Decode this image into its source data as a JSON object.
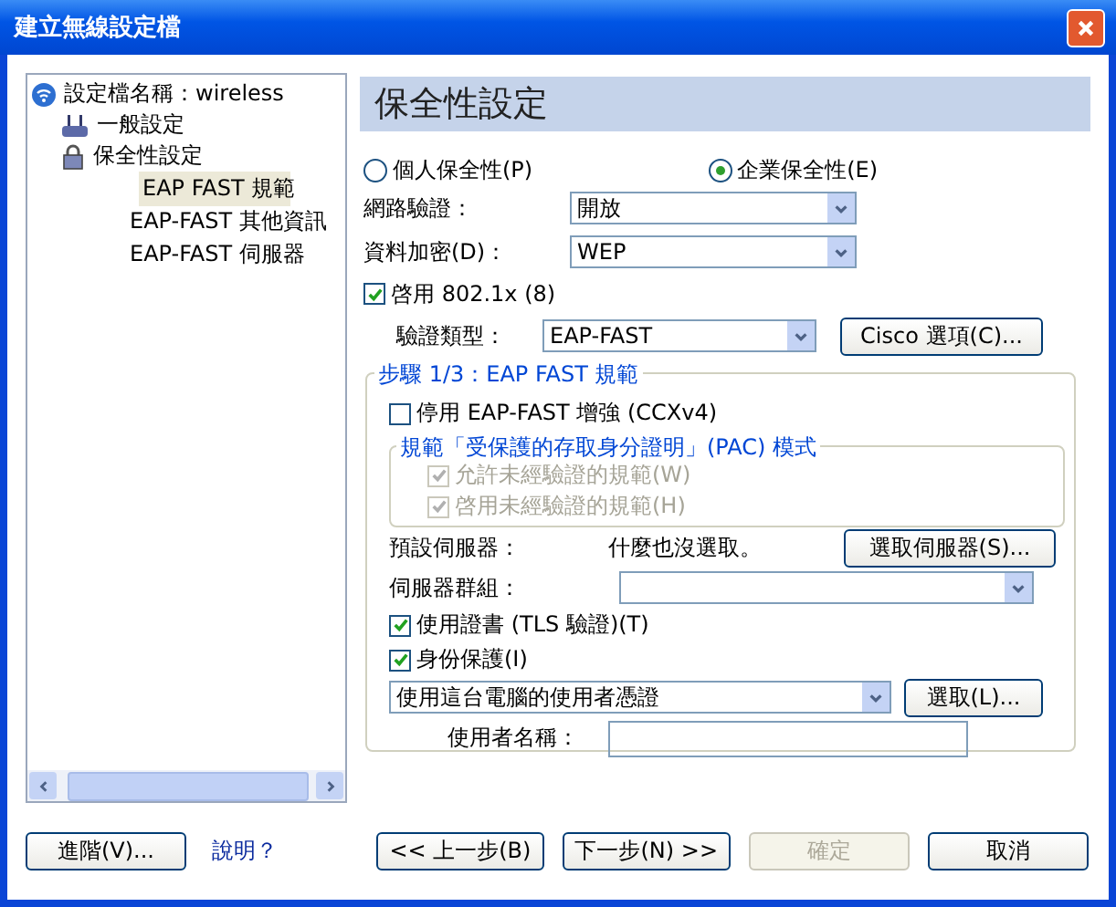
{
  "window": {
    "title": "建立無線設定檔"
  },
  "tree": {
    "label": "設定檔名稱：wireless",
    "children": [
      {
        "label": "一般設定",
        "kind": "router"
      },
      {
        "label": "保全性設定",
        "kind": "lock",
        "children": [
          {
            "label": "EAP FAST 規範",
            "selected": true
          },
          {
            "label": "EAP-FAST 其他資訊",
            "selected": false
          },
          {
            "label": "EAP-FAST 伺服器",
            "selected": false
          }
        ]
      }
    ]
  },
  "panel": {
    "heading": "保全性設定",
    "radios": [
      {
        "label": "個人保全性(P)",
        "selected": false
      },
      {
        "label": "企業保全性(E)",
        "selected": true
      }
    ],
    "network_auth": {
      "label": "網路驗證：",
      "value": "開放"
    },
    "data_encryption": {
      "label": "資料加密(D)：",
      "value": "WEP"
    },
    "enable_8021x": {
      "label": "啓用 802.1x (8)",
      "checked": true
    },
    "auth_type": {
      "label": "驗證類型：",
      "value": "EAP-FAST"
    },
    "cisco_button": "Cisco 選項(C)...",
    "step_group": {
      "title": "步驟 1/3：EAP FAST 規範",
      "disable_enhance": {
        "label": "停用 EAP-FAST 增強 (CCXv4)",
        "checked": false
      },
      "pac_group": {
        "title": "規範「受保護的存取身分證明」(PAC) 模式",
        "options": [
          {
            "label": "允許未經驗證的規範(W)",
            "checked": true,
            "disabled": true
          },
          {
            "label": "啓用未經驗證的規範(H)",
            "checked": true,
            "disabled": true
          }
        ]
      },
      "default_server": {
        "label": "預設伺服器：",
        "value": "什麼也沒選取。"
      },
      "select_server_button": "選取伺服器(S)...",
      "server_group": {
        "label": "伺服器群組："
      },
      "use_cert": {
        "label": "使用證書 (TLS 驗證)(T)",
        "checked": true
      },
      "identity": {
        "label": "身份保護(I)",
        "checked": true
      },
      "credential": {
        "value": "使用這台電腦的使用者憑證"
      },
      "select_button": "選取(L)...",
      "username": {
        "label": "使用者名稱："
      }
    }
  },
  "footer": {
    "advanced_button": "進階(V)...",
    "help_link": "說明？",
    "buttons": [
      {
        "label": "<< 上一步(B)",
        "disabled": false
      },
      {
        "label": "下一步(N) >>",
        "disabled": false
      },
      {
        "label": "確定",
        "disabled": true
      },
      {
        "label": "取消",
        "disabled": false
      }
    ]
  }
}
